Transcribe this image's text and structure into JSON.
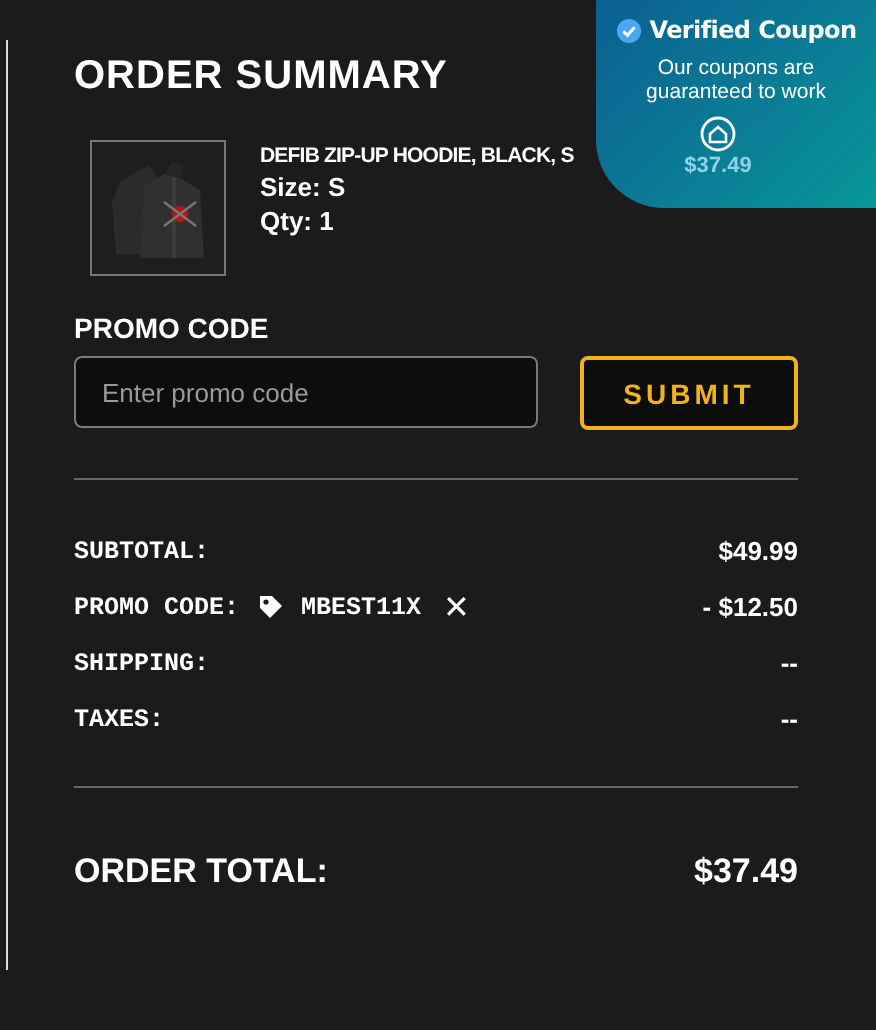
{
  "title": "ORDER SUMMARY",
  "item": {
    "name": "DEFIB ZIP-UP HOODIE, BLACK, S",
    "size": "Size: S",
    "qty": "Qty: 1",
    "price": "$37.49"
  },
  "promo": {
    "label": "PROMO CODE",
    "placeholder": "Enter promo code",
    "button": "SUBMIT"
  },
  "lines": [
    {
      "kind": "plain",
      "label": "SUBTOTAL:",
      "value": "$49.99"
    },
    {
      "kind": "promo",
      "label": "PROMO CODE:",
      "code": "MBEST11X",
      "remove": "✕",
      "value": "- $12.50"
    },
    {
      "kind": "plain",
      "label": "SHIPPING:",
      "value": "--"
    },
    {
      "kind": "plain",
      "label": "TAXES:",
      "value": "--"
    }
  ],
  "total": {
    "label": "ORDER TOTAL:",
    "value": "$37.49"
  },
  "badge": {
    "title": "Verified Coupon",
    "text": "Our coupons are guaranteed to work"
  }
}
